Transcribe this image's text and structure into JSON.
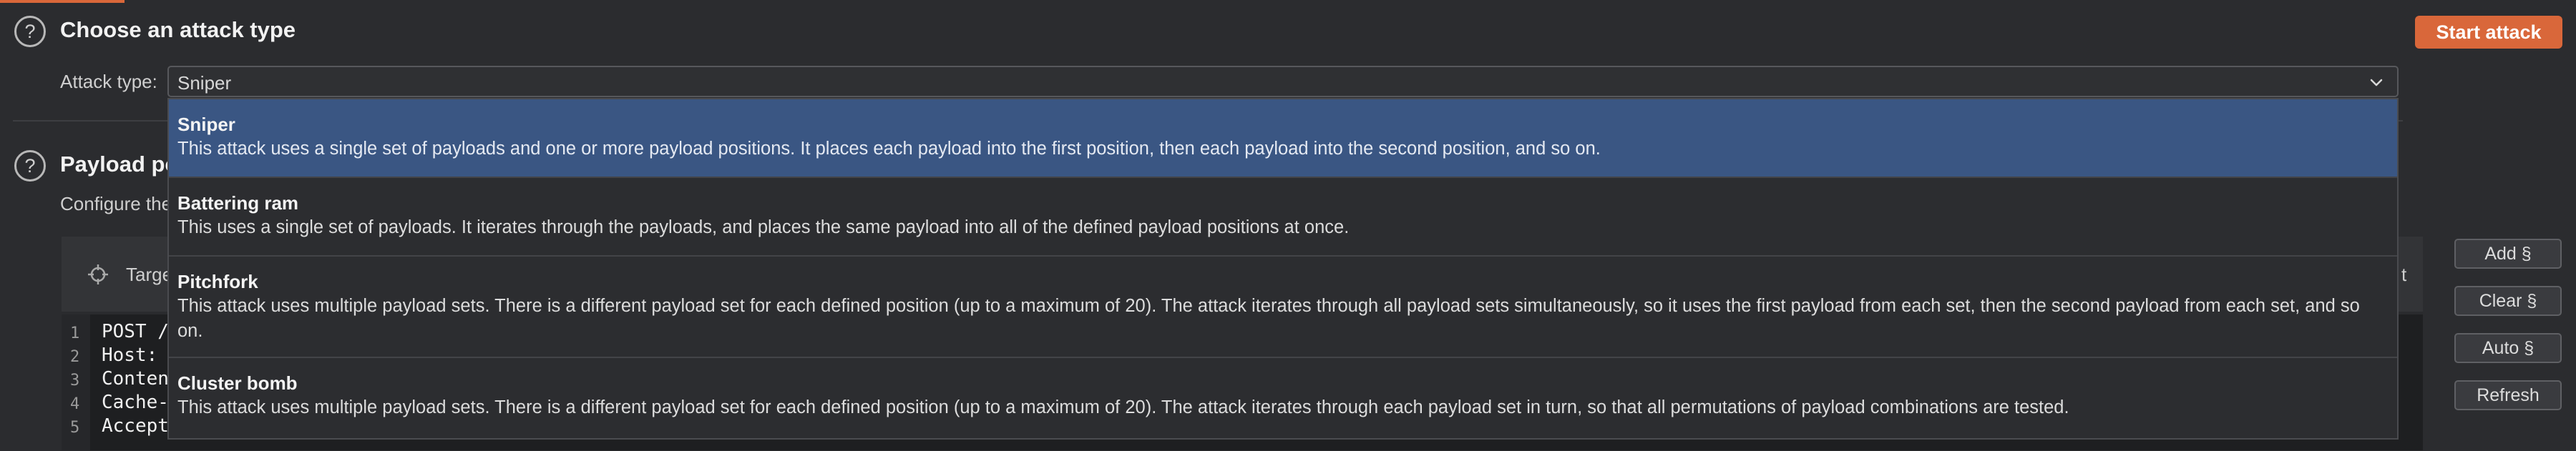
{
  "attack_section": {
    "title": "Choose an attack type",
    "attack_type_label": "Attack type:",
    "attack_type_value": "Sniper",
    "start_attack_label": "Start attack"
  },
  "payload_section": {
    "title_partial": "Payload po",
    "description_partial": "Configure the",
    "target_label_partial": "Targe",
    "target_right_partial": "t"
  },
  "editor": {
    "line_numbers": [
      "1",
      "2",
      "3",
      "4",
      "5"
    ],
    "lines": [
      "POST /",
      "Host:",
      "Conten",
      "Cache-",
      "Accept"
    ]
  },
  "side_buttons": {
    "add": "Add §",
    "clear": "Clear §",
    "auto": "Auto §",
    "refresh": "Refresh"
  },
  "dropdown_options": [
    {
      "name": "Sniper",
      "description": "This attack uses a single set of payloads and one or more payload positions. It places each payload into the first position, then each payload into the second position, and so on.",
      "selected": true
    },
    {
      "name": "Battering ram",
      "description": "This uses a single set of payloads. It iterates through the payloads, and places the same payload into all of the defined payload positions at once.",
      "selected": false
    },
    {
      "name": "Pitchfork",
      "description": "This attack uses multiple payload sets. There is a different payload set for each defined position (up to a maximum of 20). The attack iterates through all payload sets simultaneously, so it uses the first payload from each set, then the second payload from each set, and so on.",
      "selected": false
    },
    {
      "name": "Cluster bomb",
      "description": "This attack uses multiple payload sets. There is a different payload set for each defined position (up to a maximum of 20). The attack iterates through each payload set in turn, so that all permutations of payload combinations are tested.",
      "selected": false
    }
  ],
  "colors": {
    "accent": "#d9673a",
    "selected_option": "#3a5683",
    "background": "#2b2c2f"
  }
}
